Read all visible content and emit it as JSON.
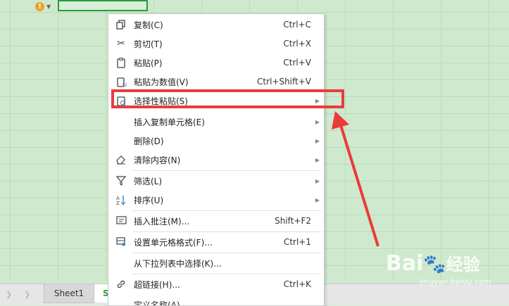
{
  "menu": {
    "items": [
      {
        "icon": "copy-icon",
        "label": "复制(C)",
        "shortcut": "Ctrl+C",
        "submenu": false
      },
      {
        "icon": "scissors-icon",
        "label": "剪切(T)",
        "shortcut": "Ctrl+X",
        "submenu": false
      },
      {
        "icon": "clipboard-icon",
        "label": "粘贴(P)",
        "shortcut": "Ctrl+V",
        "submenu": false
      },
      {
        "icon": "paste-values-icon",
        "label": "粘贴为数值(V)",
        "shortcut": "Ctrl+Shift+V",
        "submenu": false
      },
      {
        "icon": "paste-special-icon",
        "label": "选择性粘贴(S)",
        "shortcut": "",
        "submenu": true
      },
      {
        "icon": "",
        "label": "插入复制单元格(E)",
        "shortcut": "",
        "submenu": true
      },
      {
        "icon": "",
        "label": "删除(D)",
        "shortcut": "",
        "submenu": true
      },
      {
        "icon": "eraser-icon",
        "label": "清除内容(N)",
        "shortcut": "",
        "submenu": true
      },
      {
        "icon": "filter-icon",
        "label": "筛选(L)",
        "shortcut": "",
        "submenu": true
      },
      {
        "icon": "sort-icon",
        "label": "排序(U)",
        "shortcut": "",
        "submenu": true
      },
      {
        "icon": "comment-icon",
        "label": "插入批注(M)...",
        "shortcut": "Shift+F2",
        "submenu": false
      },
      {
        "icon": "format-cells-icon",
        "label": "设置单元格格式(F)...",
        "shortcut": "Ctrl+1",
        "submenu": false
      },
      {
        "icon": "",
        "label": "从下拉列表中选择(K)...",
        "shortcut": "",
        "submenu": false
      },
      {
        "icon": "link-icon",
        "label": "超链接(H)...",
        "shortcut": "Ctrl+K",
        "submenu": false
      },
      {
        "icon": "",
        "label": "定义名称(A)...",
        "shortcut": "",
        "submenu": false
      }
    ]
  },
  "tabs": {
    "sheet1": "Sheet1",
    "partial": "S"
  },
  "watermark": {
    "brand": "Bai",
    "brand2": "经验",
    "sub": "jingyan.baidu.com"
  },
  "colors": {
    "highlight": "#ea3b3b",
    "grid_bg": "#cfe9cf",
    "active_cell": "#2e9a3a"
  }
}
